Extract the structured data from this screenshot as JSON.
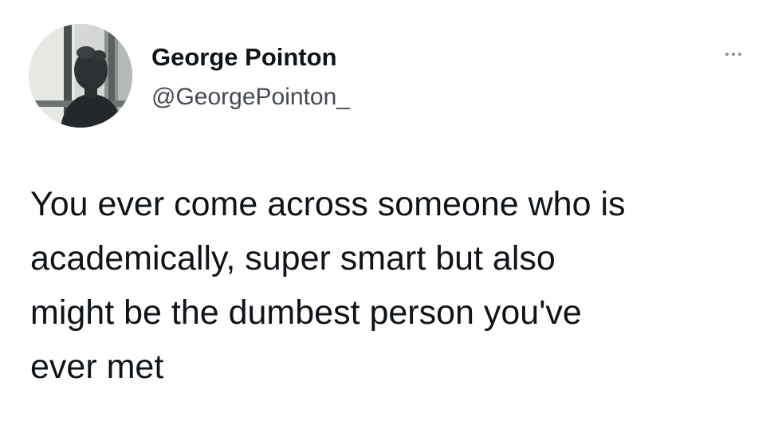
{
  "author": {
    "display_name": "George Pointon",
    "handle": "@GeorgePointon_"
  },
  "tweet": {
    "text": "You ever come across someone who is\nacademically, super smart but also\nmight be the dumbest person you've\never met"
  },
  "icons": {
    "more": "more-options-icon",
    "avatar": "profile-avatar"
  },
  "colors": {
    "text": "#0f1419",
    "handle": "#444a50",
    "background": "#ffffff"
  }
}
